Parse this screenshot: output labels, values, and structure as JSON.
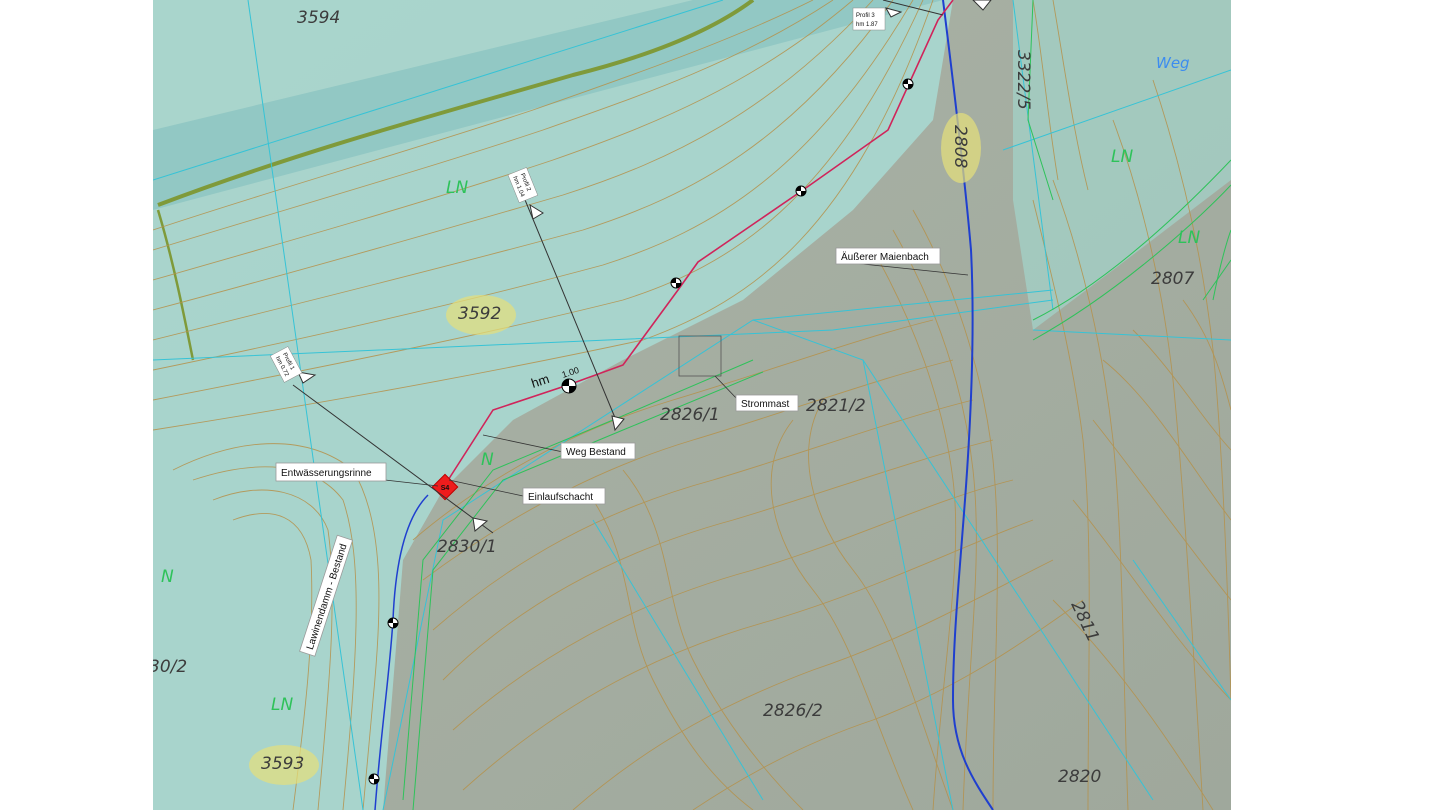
{
  "map": {
    "parcels": [
      "3594",
      "3592",
      "3593",
      "2826/1",
      "2821/2",
      "2830/1",
      "2826/2",
      "2807",
      "2811",
      "2820",
      "2808",
      "3322/5",
      "30/2"
    ],
    "labels": {
      "strommast": "Strommast",
      "weg_bestand": "Weg Bestand",
      "einlaufschacht": "Einlaufschacht",
      "entwaesserungsrinne": "Entwässerungsrinne",
      "aeusserer_maienbach": "Äußerer Maienbach",
      "lawinendamm": "Lawinendamm - Bestand",
      "weg": "Weg",
      "hm": "hm",
      "hm_value": "1.00",
      "ln": "LN",
      "n": "N",
      "marker_code": "S4"
    },
    "profiles": [
      {
        "name": "Profil 1",
        "hm": "hm 0.72"
      },
      {
        "name": "Profil 2",
        "hm": "hm 1.04"
      },
      {
        "name": "Profil 3",
        "hm": "hm 1.87"
      }
    ],
    "colors": {
      "meadow": "#a8d8d0",
      "forest": "#a9b3a4",
      "contour": "#b5914a",
      "parcel_line": "#36c3d6",
      "land_use": "#2ec25a",
      "stream": "#1f3fcf",
      "path": "#d0245a",
      "marker": "#ee1c1c"
    }
  }
}
